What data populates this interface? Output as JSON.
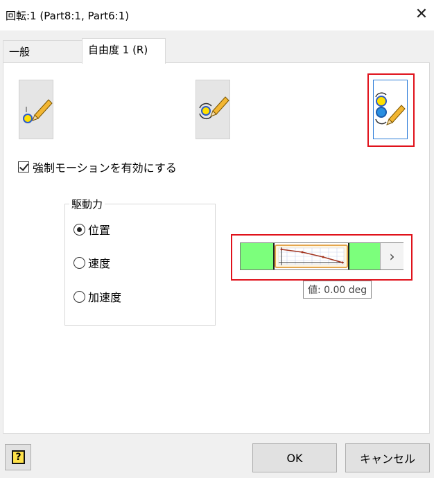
{
  "window": {
    "title": "回転:1 (Part8:1, Part6:1)",
    "close_glyph": "✕"
  },
  "tabs": [
    {
      "label": "一般",
      "active": false
    },
    {
      "label": "自由度 1 (R)",
      "active": true
    }
  ],
  "dof_buttons": [
    {
      "icon": "fixed-dof-pencil-icon",
      "selected": false
    },
    {
      "icon": "free-rotation-pencil-icon",
      "selected": false
    },
    {
      "icon": "imposed-motion-pencil-icon",
      "selected": true
    }
  ],
  "imposed_motion": {
    "checkbox_label": "強制モーションを有効にする",
    "checked": true
  },
  "driving": {
    "legend": "駆動力",
    "options": [
      {
        "label": "位置",
        "checked": true
      },
      {
        "label": "速度",
        "checked": false
      },
      {
        "label": "加速度",
        "checked": false
      }
    ]
  },
  "motion_widget": {
    "tooltip": "値: 0.00 deg",
    "arrow_glyph": "›",
    "colors": {
      "green": "#7cff7c",
      "curve": "#a3341f",
      "highlight": "#e0121b"
    }
  },
  "footer": {
    "help_label": "?",
    "ok_label": "OK",
    "cancel_label": "キャンセル"
  }
}
